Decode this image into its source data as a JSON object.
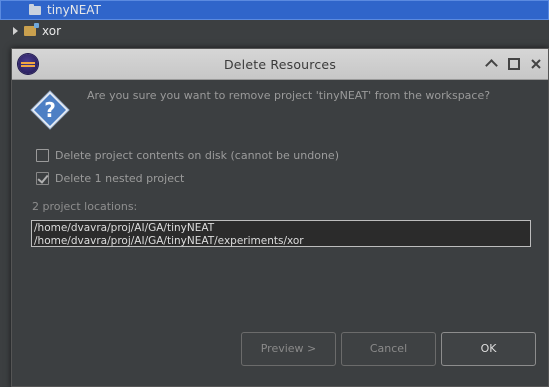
{
  "tree": {
    "items": [
      {
        "label": "tinyNEAT",
        "selected": true,
        "icon": "folder-icon"
      },
      {
        "label": "xor",
        "selected": false,
        "icon": "project-folder-icon"
      }
    ]
  },
  "dialog": {
    "title": "Delete Resources",
    "app_icon": "eclipse-icon",
    "message": "Are you sure you want to remove project 'tinyNEAT' from the workspace?",
    "options": [
      {
        "label": "Delete project contents on disk (cannot be undone)",
        "checked": false
      },
      {
        "label": "Delete 1 nested project",
        "checked": true
      }
    ],
    "locations_label": "2 project locations:",
    "locations": [
      "/home/dvavra/proj/AI/GA/tinyNEAT",
      "/home/dvavra/proj/AI/GA/tinyNEAT/experiments/xor"
    ],
    "buttons": {
      "preview": "Preview >",
      "cancel": "Cancel",
      "ok": "OK"
    }
  },
  "colors": {
    "background": "#3c3f41",
    "selection": "#2f65ca",
    "titlebar": "#d0d0d0"
  }
}
